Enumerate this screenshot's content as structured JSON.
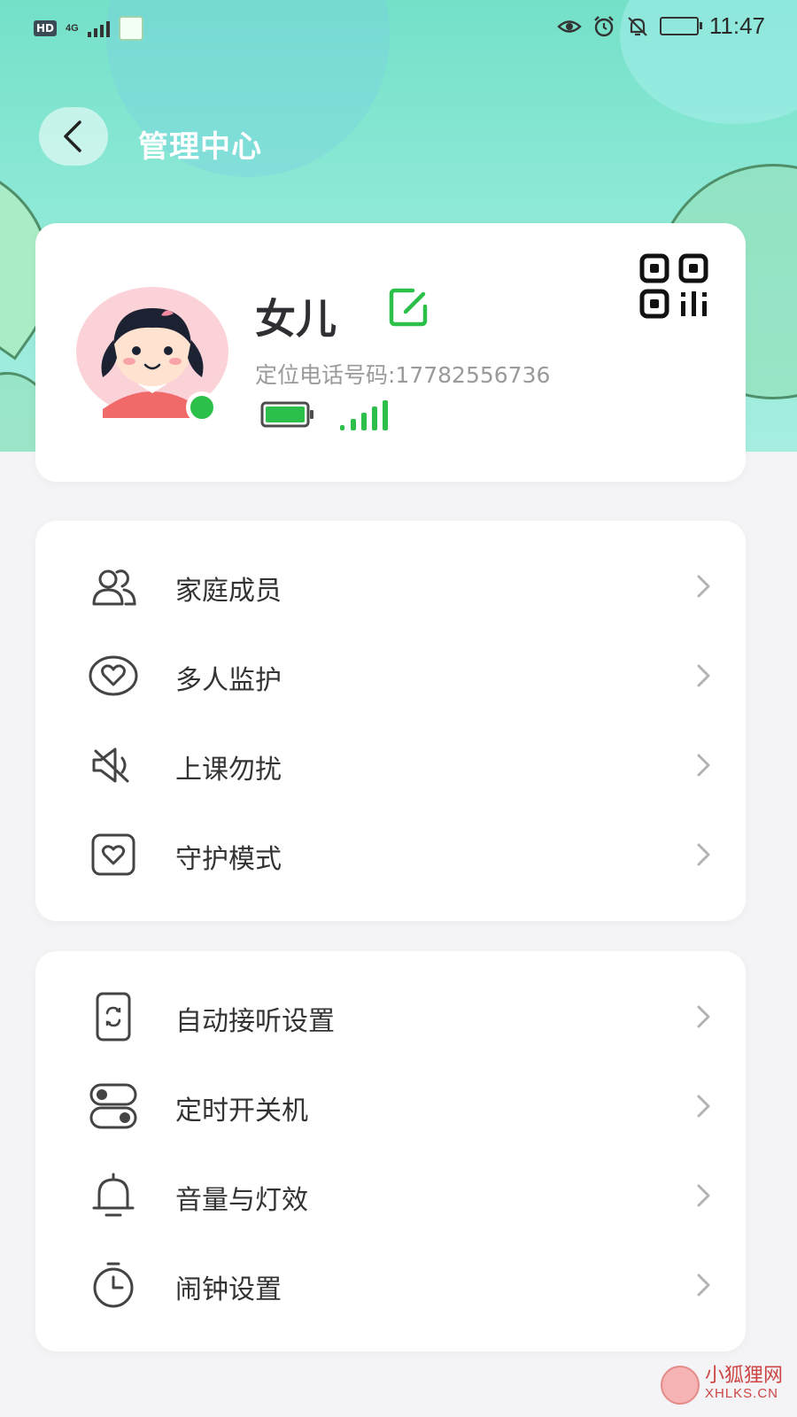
{
  "status_bar": {
    "hd_label": "HD",
    "network_label": "4G",
    "time": "11:47",
    "icons": [
      "eye-comfort-icon",
      "alarm-icon",
      "bell-off-icon",
      "battery-icon"
    ]
  },
  "header": {
    "title": "管理中心",
    "back_icon": "chevron-left-icon"
  },
  "profile": {
    "name": "女儿",
    "phone_line": "定位电话号码:17782556736",
    "online": true,
    "battery_level": 1.0,
    "signal_bars_active": 4,
    "signal_bars_total": 5,
    "accent_color": "#2cc04a"
  },
  "menu_group_1": {
    "items": [
      {
        "label": "家庭成员",
        "icon": "family-members-icon"
      },
      {
        "label": "多人监护",
        "icon": "heart-circle-icon"
      },
      {
        "label": "上课勿扰",
        "icon": "speaker-mute-icon"
      },
      {
        "label": "守护模式",
        "icon": "heart-box-icon"
      }
    ]
  },
  "menu_group_2": {
    "items": [
      {
        "label": "自动接听设置",
        "icon": "phone-auto-answer-icon"
      },
      {
        "label": "定时开关机",
        "icon": "toggle-switch-icon"
      },
      {
        "label": "音量与灯效",
        "icon": "bell-icon"
      },
      {
        "label": "闹钟设置",
        "icon": "timer-icon"
      }
    ]
  },
  "watermark": {
    "cn": "小狐狸网",
    "en": "XHLKS.CN"
  }
}
